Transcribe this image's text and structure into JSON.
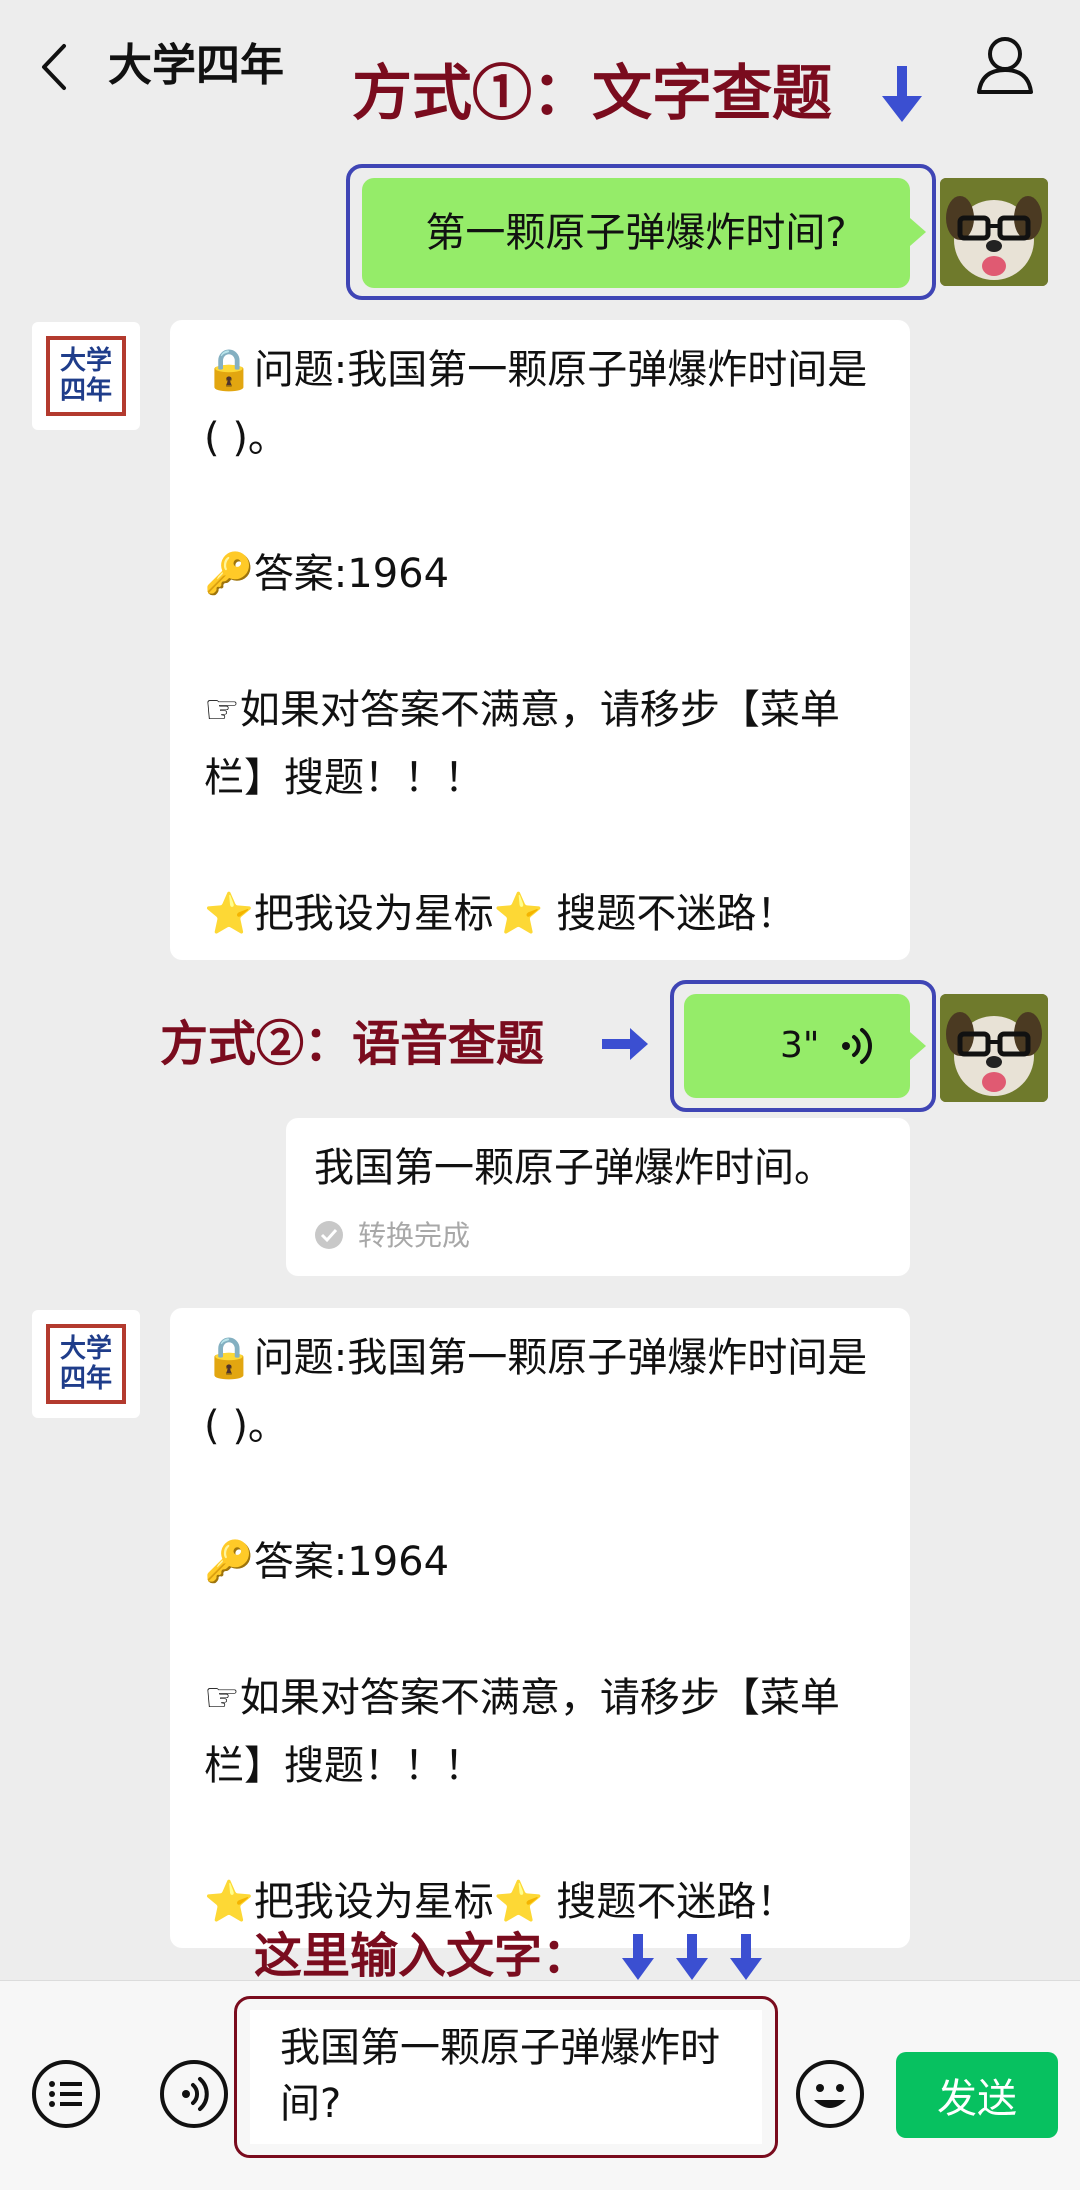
{
  "header": {
    "back_icon": "chevron-left-icon",
    "title": "大学四年",
    "profile_icon": "person-icon"
  },
  "annotations": {
    "method1": "方式①：文字查题",
    "method2": "方式②：语音查题",
    "input_hint": "这里输入文字：",
    "arrow_color": "#3b4fd1",
    "text_color": "#7a0c1e"
  },
  "messages": {
    "user_text": "第一颗原子弹爆炸时间?",
    "bot_reply": {
      "question": "问题:我国第一颗原子弹爆炸时间是( )。",
      "answer": "答案:1964",
      "hint": "☞如果对答案不满意，请移步【菜单栏】搜题！！！",
      "footer": "把我设为星标",
      "footer_tail": "搜题不迷路！"
    },
    "voice_duration": "3\"",
    "voice_transcript": "我国第一颗原子弹爆炸时间。",
    "transcript_status": "转换完成",
    "bot_avatar_line1": "大学",
    "bot_avatar_line2": "四年"
  },
  "input_bar": {
    "menu_icon": "list-icon",
    "voice_icon": "voice-icon",
    "input_value": "我国第一颗原子弹爆炸时间?",
    "emoji_icon": "emoji-icon",
    "send_label": "发送"
  },
  "colors": {
    "green_bubble": "#95ec69",
    "send_button": "#07c160",
    "background": "#ededed"
  }
}
